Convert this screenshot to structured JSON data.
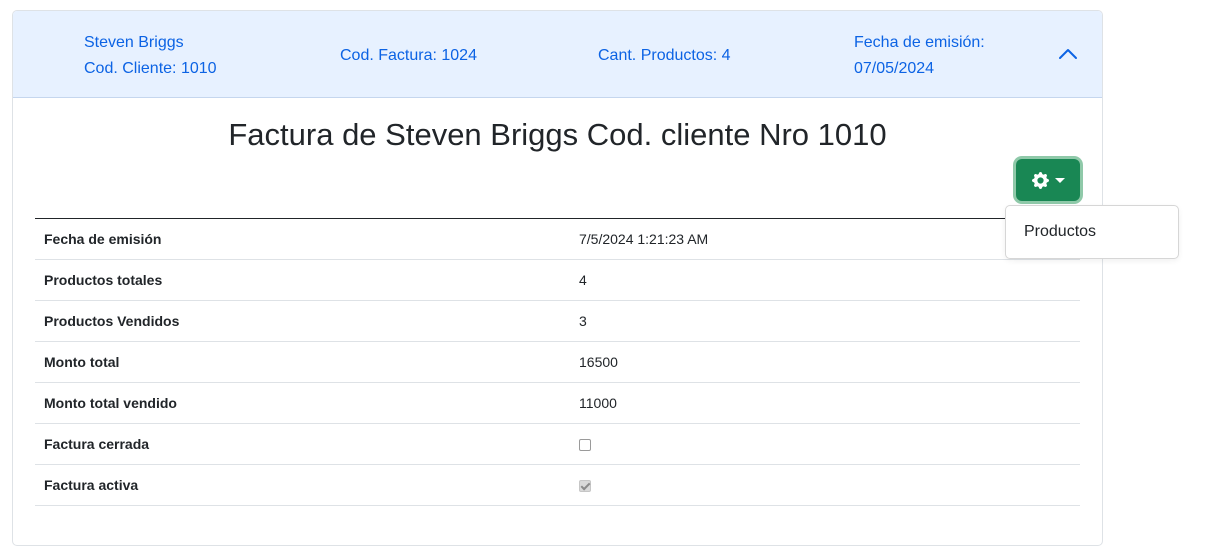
{
  "header": {
    "client_name": "Steven Briggs",
    "client_code": "Cod. Cliente: 1010",
    "invoice_code": "Cod. Factura: 1024",
    "product_count": "Cant. Productos: 4",
    "issue_label": "Fecha de emisión:",
    "issue_date": "07/05/2024",
    "chevron_icon": "chevron-up-icon"
  },
  "main": {
    "title": "Factura de Steven Briggs Cod. cliente Nro 1010",
    "settings_icon": "gear-icon",
    "rows": [
      {
        "label": "Fecha de emisión",
        "value": "7/5/2024 1:21:23 AM"
      },
      {
        "label": "Productos totales",
        "value": "4"
      },
      {
        "label": "Productos Vendidos",
        "value": "3"
      },
      {
        "label": "Monto total",
        "value": "16500"
      },
      {
        "label": "Monto total vendido",
        "value": "11000"
      },
      {
        "label": "Factura cerrada",
        "checked": false
      },
      {
        "label": "Factura activa",
        "checked": true
      }
    ]
  },
  "dropdown": {
    "items": [
      "Productos"
    ]
  },
  "colors": {
    "header_bg": "#e7f1ff",
    "header_text": "#0c63e4",
    "button_green": "#198754"
  }
}
